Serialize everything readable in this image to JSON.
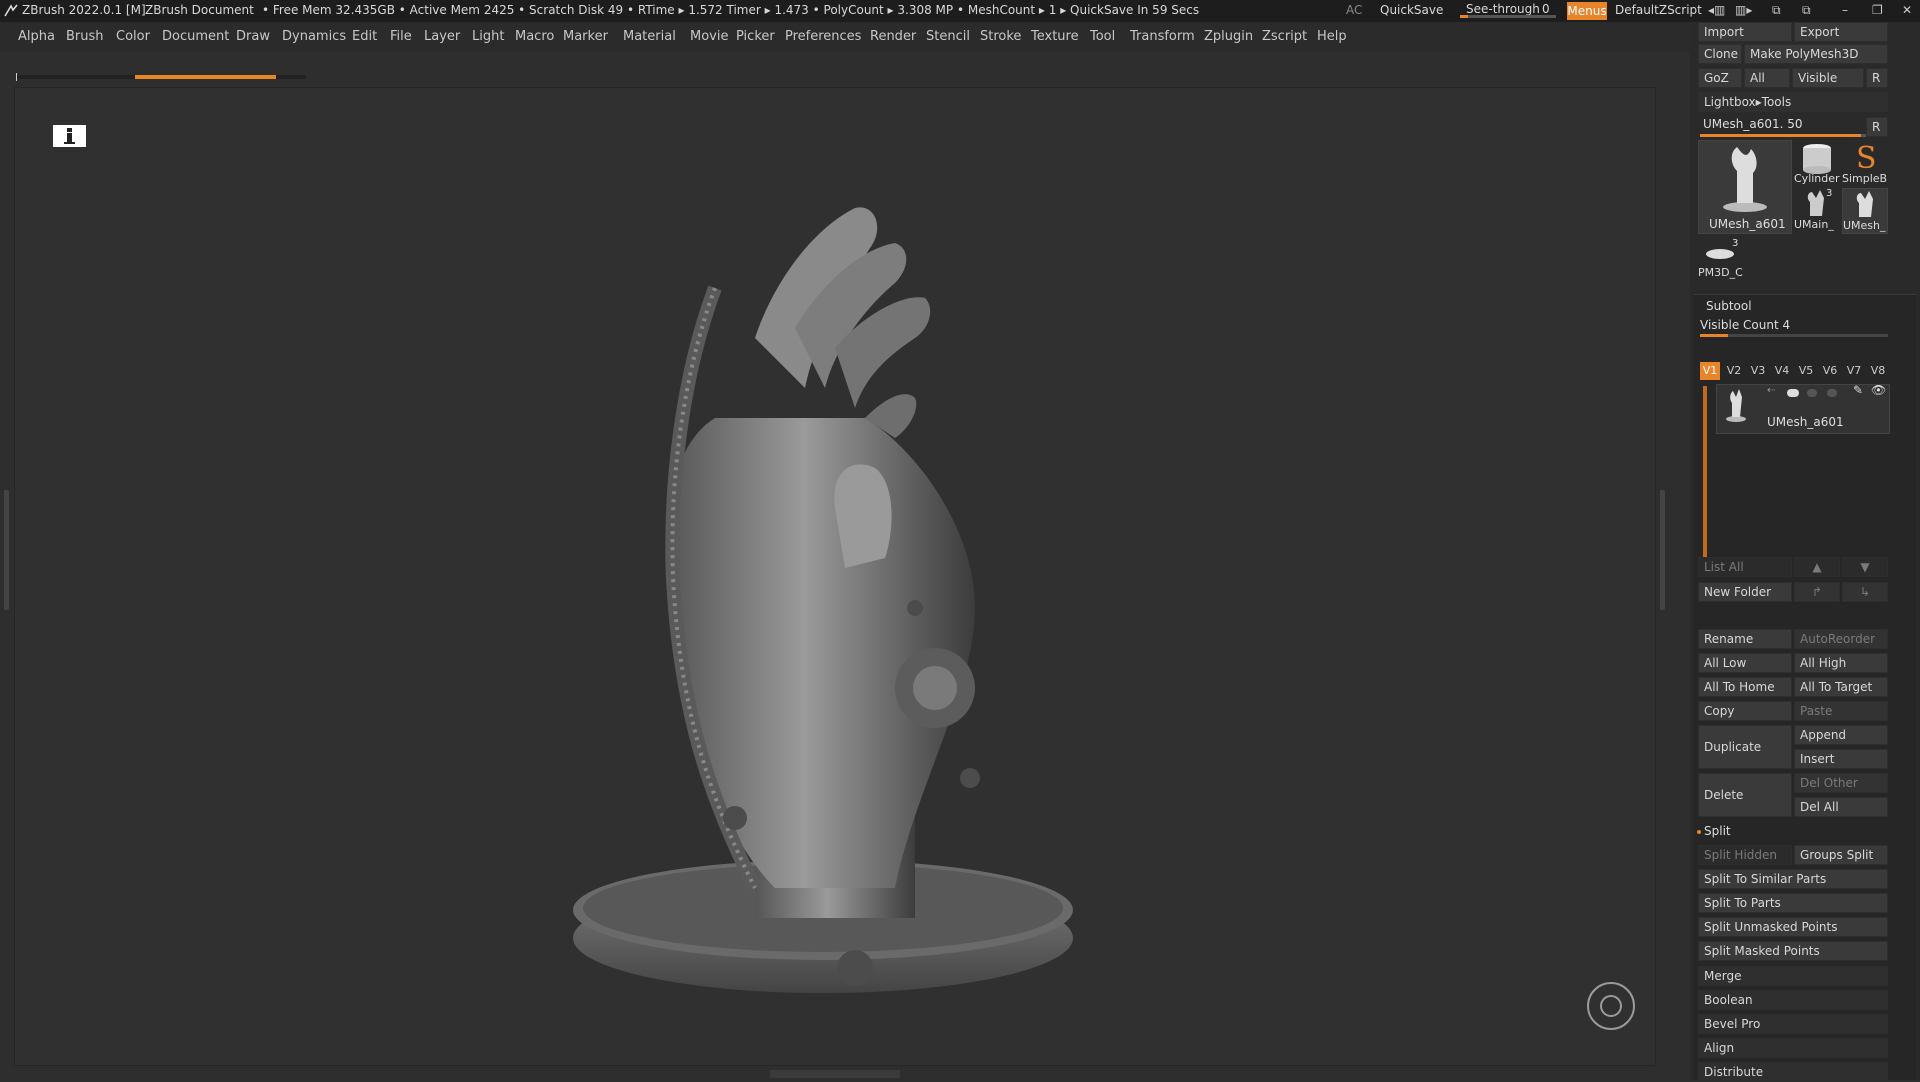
{
  "titlebar": {
    "app": "ZBrush 2022.0.1 [M]",
    "document": "ZBrush Document",
    "stats": "• Free Mem 32.435GB • Active Mem 2425 • Scratch Disk 49 •  RTime ▸ 1.572 Timer ▸ 1.473 • PolyCount ▸ 3.308 MP  • MeshCount ▸ 1  ▸ QuickSave In 59 Secs",
    "ac": "AC",
    "quicksave": "QuickSave",
    "see_through": "See-through",
    "see_through_value": "0",
    "see_through_fraction": 0,
    "menus": "Menus",
    "script": "DefaultZScript"
  },
  "menubar": [
    "Alpha",
    "Brush",
    "Color",
    "Document",
    "Draw",
    "Dynamics",
    "Edit",
    "File",
    "Layer",
    "Light",
    "Macro",
    "Marker",
    "Material",
    "Movie",
    "Picker",
    "Preferences",
    "Render",
    "Stencil",
    "Stroke",
    "Texture",
    "Tool",
    "Transform",
    "Zplugin",
    "Zscript",
    "Help"
  ],
  "progress": {
    "fraction": 0.4
  },
  "tool": {
    "import": "Import",
    "export": "Export",
    "clone": "Clone",
    "make_polymesh": "Make PolyMesh3D",
    "goz": "GoZ",
    "all": "All",
    "visible": "Visible",
    "r": "R",
    "lightbox": "Lightbox▸Tools",
    "current_name": "UMesh_a601. 50",
    "current_fraction": 0.97,
    "thumbs": {
      "main": "UMesh_a601",
      "cylinder": "Cylinder",
      "simpleb": "SimpleB",
      "umain": "UMain_",
      "umesh": "UMesh_",
      "umain_count": "3",
      "pm3d": "PM3D_C",
      "pm3d_count": "3"
    }
  },
  "subtool": {
    "title": "Subtool",
    "visible_count": "Visible Count 4",
    "visible_fraction": 0.5,
    "tabs": [
      "V1",
      "V2",
      "V3",
      "V4",
      "V5",
      "V6",
      "V7",
      "V8"
    ],
    "active_tab": "V1",
    "item_name": "UMesh_a601",
    "list_all": "List All",
    "new_folder": "New Folder",
    "rename": "Rename",
    "autoreorder": "AutoReorder",
    "all_low": "All Low",
    "all_high": "All High",
    "all_to_home": "All To Home",
    "all_to_target": "All To Target",
    "copy": "Copy",
    "paste": "Paste",
    "duplicate": "Duplicate",
    "append": "Append",
    "insert": "Insert",
    "delete": "Delete",
    "del_other": "Del Other",
    "del_all": "Del All",
    "split": "Split",
    "split_hidden": "Split Hidden",
    "groups_split": "Groups Split",
    "split_similar": "Split To Similar Parts",
    "split_parts": "Split To Parts",
    "split_unmasked": "Split Unmasked Points",
    "split_masked": "Split Masked Points",
    "merge": "Merge",
    "boolean": "Boolean",
    "bevel_pro": "Bevel Pro",
    "align": "Align",
    "distribute": "Distribute"
  },
  "colors": {
    "accent": "#e8842a",
    "panel": "#2a2a2a",
    "canvas": "#303030"
  }
}
